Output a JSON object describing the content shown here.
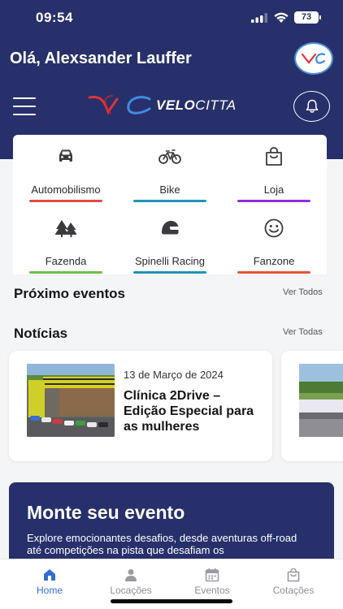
{
  "status_bar": {
    "time": "09:54",
    "battery": "73"
  },
  "header": {
    "greeting": "Olá, Alexsander Lauffer",
    "logo_text_bold": "VELO",
    "logo_text_rest": "CITTA",
    "colors": {
      "background": "#27306a",
      "logo_red": "#e0323a",
      "logo_blue": "#3c8ce0"
    }
  },
  "categories": [
    {
      "label": "Automobilismo",
      "icon": "car-icon",
      "color": "#e04a44"
    },
    {
      "label": "Bike",
      "icon": "bicycle-icon",
      "color": "#1f95b5"
    },
    {
      "label": "Loja",
      "icon": "shopping-bag-icon",
      "color": "#8e2fd6"
    },
    {
      "label": "Fazenda",
      "icon": "trees-icon",
      "color": "#6cc04a"
    },
    {
      "label": "Spinelli Racing",
      "icon": "helmet-icon",
      "color": "#1f95b5"
    },
    {
      "label": "Fanzone",
      "icon": "smiley-icon",
      "color": "#e8553e"
    }
  ],
  "sections": {
    "events": {
      "title": "Próximo eventos",
      "see_all": "Ver Todos"
    },
    "news": {
      "title": "Notícias",
      "see_all": "Ver Todas"
    }
  },
  "news": [
    {
      "date": "13 de Março de 2024",
      "title": "Clínica 2Drive – Edição Especial para as mulheres"
    }
  ],
  "promo": {
    "title": "Monte seu evento",
    "description": "Explore emocionantes desafios, desde aventuras off-road até competições na pista que desafiam os"
  },
  "tabs": [
    {
      "label": "Home",
      "icon": "home-icon",
      "active": true
    },
    {
      "label": "Locações",
      "icon": "user-icon",
      "active": false
    },
    {
      "label": "Eventos",
      "icon": "calendar-icon",
      "active": false
    },
    {
      "label": "Cotações",
      "icon": "bag-icon",
      "active": false
    }
  ]
}
